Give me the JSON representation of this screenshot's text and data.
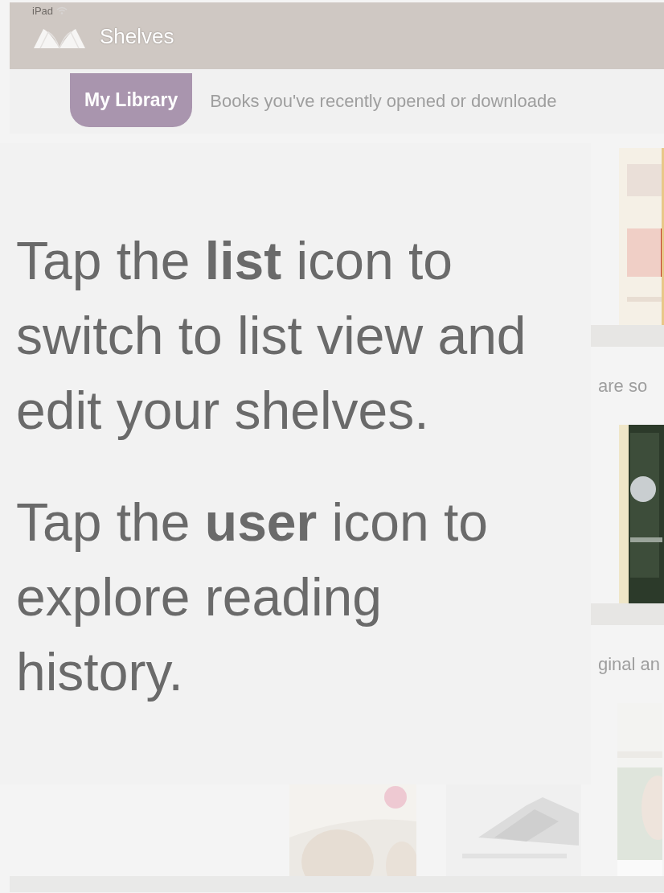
{
  "status_bar": {
    "device": "iPad"
  },
  "header": {
    "title": "Shelves"
  },
  "tabs": [
    {
      "label": "My Library",
      "selected": true
    }
  ],
  "subtitle": "Books you've recently opened or downloade",
  "shelves": [
    {
      "caption": "are so"
    },
    {
      "caption": "ginal an"
    }
  ],
  "tutorial": {
    "paragraphs": [
      "Tap the **list** icon to switch to list view and edit your shelves.",
      "Tap the **user** icon to explore reading history."
    ]
  }
}
